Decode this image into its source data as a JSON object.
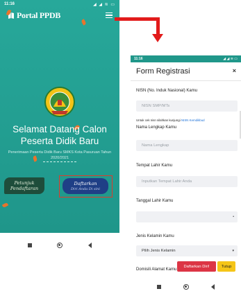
{
  "landing": {
    "status_time": "11:16",
    "status_icons": "◢ ◢ ≋ ▭",
    "brand": "Portal PPDB",
    "welcome_line1": "Selamat Datang Calon",
    "welcome_line2": "Peserta Didik Baru",
    "subtitle": "Penerimaan Peserta Didik Baru SMKS Kota Pasuruan Tahun 2020/2021",
    "btn_petunjuk_line1": "Petunjuk",
    "btn_petunjuk_line2": "Pendaftaran",
    "btn_daftar_line1": "Daftarkan",
    "btn_daftar_line2": "Diri Anda Di sini",
    "colors": {
      "background": "#1f968a",
      "accent_leaf": "#e8742c",
      "highlight_box": "#e03a2a",
      "arrow": "#e21b1b"
    }
  },
  "form": {
    "status_time": "11:16",
    "status_icons": "◢ ◢ ≋ ▭",
    "title": "Form Registrasi",
    "close": "×",
    "fields": [
      {
        "label": "NISN (No. Induk Nasional) Kamu",
        "placeholder": "NISN SMP/MTs"
      },
      {
        "label": "Nama Lengkap Kamu",
        "placeholder": "Nama Lengkap"
      },
      {
        "label": "Tempat Lahir Kamu",
        "placeholder": "Inputkan Tempat Lahir Anda"
      },
      {
        "label": "Tanggal Lahir Kamu",
        "placeholder": ""
      },
      {
        "label": "Jenis Kelamin Kamu",
        "value": "Pilih Jenis Kelamin"
      },
      {
        "label": "Domisili Alamat Kamu"
      }
    ],
    "helper_prefix": "Untuk cek nisn silahkan kunjungi",
    "helper_link": "NISN Kemdikbud",
    "submit": "Daftarkan Diri!",
    "tutup": "Tutup"
  }
}
